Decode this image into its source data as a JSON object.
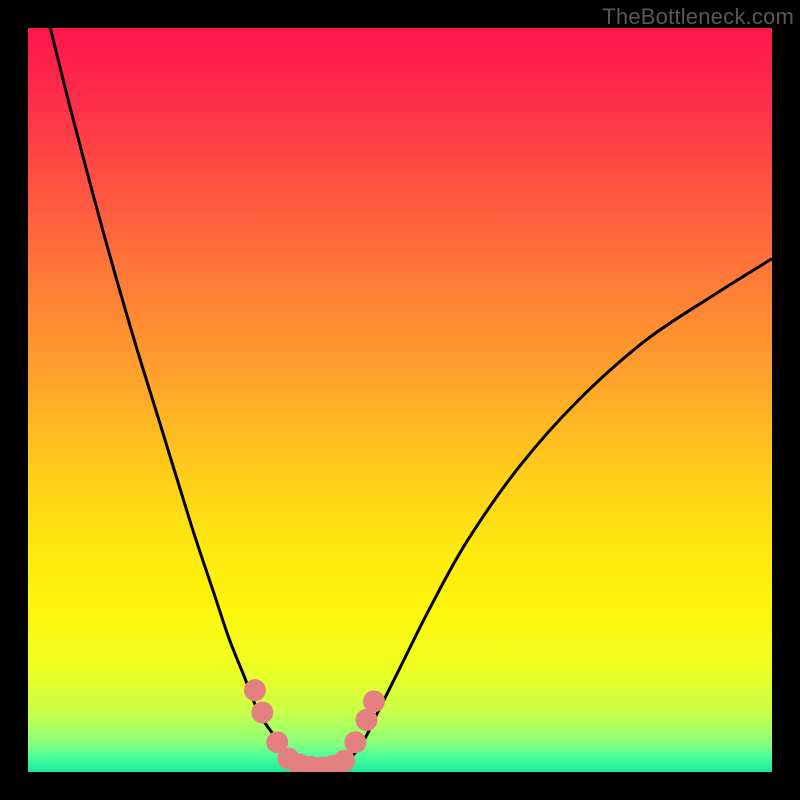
{
  "watermark": "TheBottleneck.com",
  "chart_data": {
    "type": "line",
    "title": "",
    "xlabel": "",
    "ylabel": "",
    "xlim": [
      0,
      100
    ],
    "ylim": [
      0,
      100
    ],
    "grid": false,
    "legend": false,
    "series": [
      {
        "name": "left-curve",
        "x": [
          3,
          6,
          10,
          14,
          18,
          22,
          25,
          27,
          29,
          31,
          33,
          34.5,
          36,
          37
        ],
        "y": [
          100,
          88,
          73,
          59,
          46,
          33,
          24,
          18,
          13,
          8,
          5,
          3,
          1.5,
          1
        ]
      },
      {
        "name": "right-curve",
        "x": [
          42,
          43,
          45,
          47,
          50,
          54,
          59,
          66,
          74,
          83,
          92,
          100
        ],
        "y": [
          1,
          1.5,
          4,
          8,
          14,
          22,
          31,
          41,
          50,
          58,
          64,
          69
        ]
      },
      {
        "name": "bottom-flat",
        "x": [
          35,
          37,
          39,
          41,
          43
        ],
        "y": [
          1.5,
          0.8,
          0.6,
          0.8,
          1.5
        ]
      }
    ],
    "markers": [
      {
        "series": "left-curve",
        "x": 30.5,
        "y": 11
      },
      {
        "series": "left-curve",
        "x": 31.5,
        "y": 8
      },
      {
        "series": "left-curve",
        "x": 33.5,
        "y": 4
      },
      {
        "series": "left-curve",
        "x": 35,
        "y": 1.8
      },
      {
        "series": "left-curve",
        "x": 36.5,
        "y": 1
      },
      {
        "series": "left-curve",
        "x": 38,
        "y": 0.7
      },
      {
        "series": "left-curve",
        "x": 39.5,
        "y": 0.6
      },
      {
        "series": "right-curve",
        "x": 41,
        "y": 0.8
      },
      {
        "series": "right-curve",
        "x": 42.5,
        "y": 1.5
      },
      {
        "series": "right-curve",
        "x": 44,
        "y": 4
      },
      {
        "series": "right-curve",
        "x": 45.5,
        "y": 7
      },
      {
        "series": "right-curve",
        "x": 46.5,
        "y": 9.5
      }
    ],
    "colors": {
      "curve_stroke": "#000000",
      "marker_fill": "#e58080",
      "gradient_top": "#ff164c",
      "gradient_bottom": "#18e89e",
      "background": "#000000"
    }
  }
}
